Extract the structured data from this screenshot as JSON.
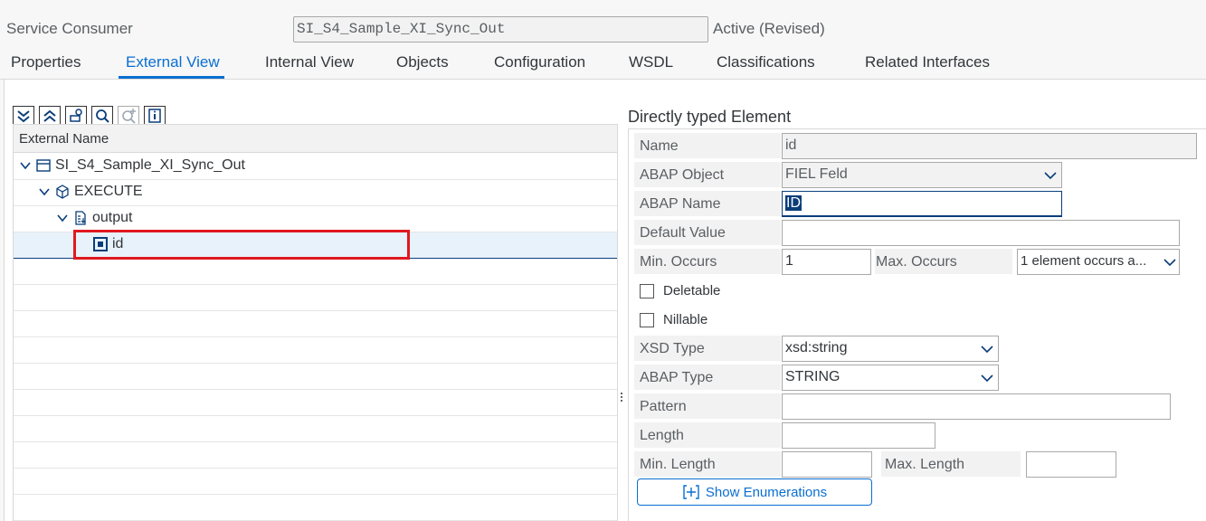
{
  "header": {
    "label": "Service Consumer",
    "name": "SI_S4_Sample_XI_Sync_Out",
    "status": "Active (Revised)"
  },
  "tabs": [
    {
      "label": "Properties"
    },
    {
      "label": "External View",
      "active": true
    },
    {
      "label": "Internal View"
    },
    {
      "label": "Objects"
    },
    {
      "label": "Configuration"
    },
    {
      "label": "WSDL"
    },
    {
      "label": "Classifications"
    },
    {
      "label": "Related Interfaces"
    }
  ],
  "toolbar": {
    "icons": [
      "expand-all-icon",
      "collapse-all-icon",
      "assign-icon",
      "find-icon",
      "find-next-icon",
      "info-icon"
    ]
  },
  "tree": {
    "column_header": "External Name",
    "nodes": [
      {
        "label": "SI_S4_Sample_XI_Sync_Out",
        "icon": "service-interface-icon",
        "expanded": true
      },
      {
        "label": "EXECUTE",
        "icon": "operation-icon",
        "expanded": true
      },
      {
        "label": "output",
        "icon": "message-icon",
        "expanded": true
      },
      {
        "label": "id",
        "icon": "element-icon",
        "selected": true
      }
    ]
  },
  "details": {
    "title": "Directly typed Element",
    "name_label": "Name",
    "name_value": "id",
    "abap_object_label": "ABAP Object",
    "abap_object_value": "FIEL Feld",
    "abap_name_label": "ABAP Name",
    "abap_name_value": "ID",
    "default_value_label": "Default Value",
    "default_value": "",
    "min_occurs_label": "Min. Occurs",
    "min_occurs_value": "1",
    "max_occurs_label": "Max. Occurs",
    "max_occurs_value": "1 element occurs a...",
    "deletable_label": "Deletable",
    "deletable_checked": false,
    "nillable_label": "Nillable",
    "nillable_checked": false,
    "xsd_type_label": "XSD Type",
    "xsd_type_value": "xsd:string",
    "abap_type_label": "ABAP Type",
    "abap_type_value": "STRING",
    "pattern_label": "Pattern",
    "pattern_value": "",
    "length_label": "Length",
    "length_value": "",
    "min_length_label": "Min. Length",
    "min_length_value": "",
    "max_length_label": "Max. Length",
    "max_length_value": "",
    "show_enum_label": "Show Enumerations"
  },
  "colors": {
    "accent": "#0a6ed1",
    "highlight_box": "#e0191f",
    "selection": "#0a3d7a"
  }
}
